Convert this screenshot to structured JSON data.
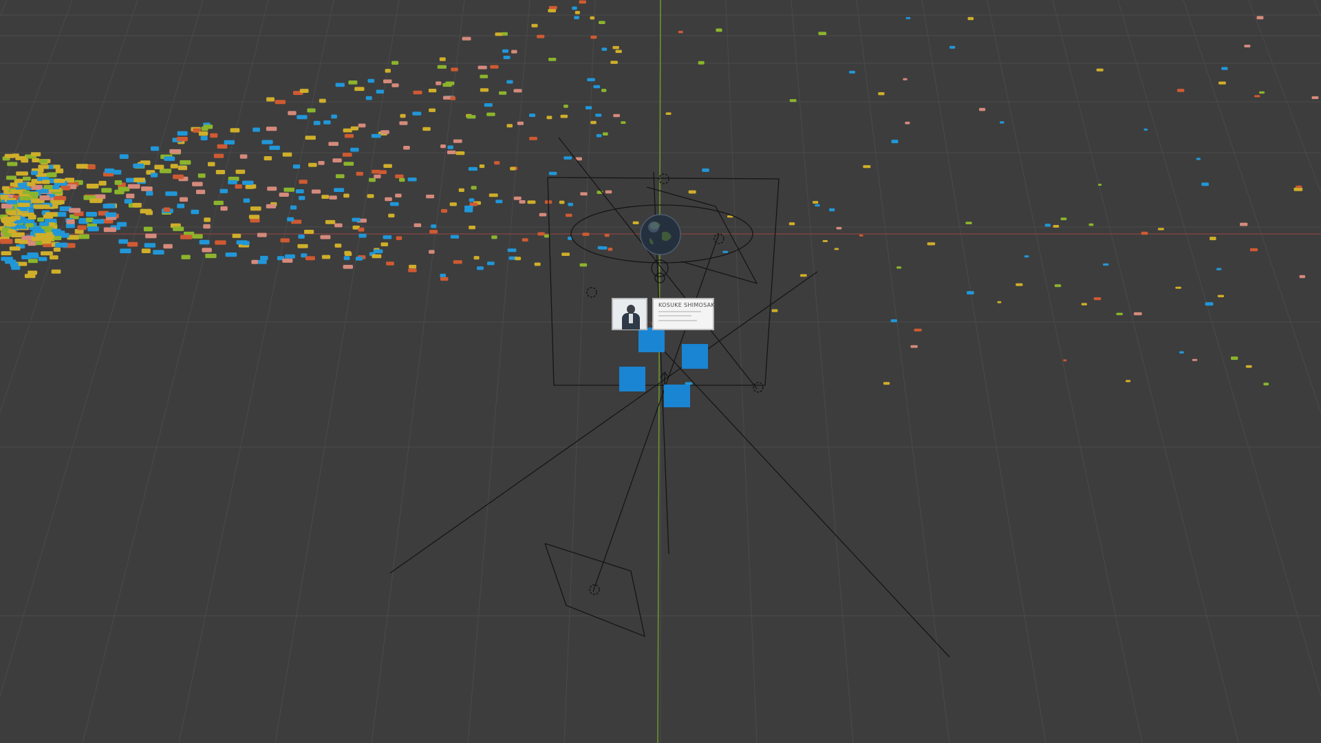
{
  "viewport": {
    "background_color": "#3d3d3d",
    "grid_color": "#4a4a4a",
    "x_axis_color": "#9a4545",
    "y_axis_color": "#6c9a2a",
    "wire_color": "#151515"
  },
  "object_colors": {
    "blue": "#2197d8",
    "yellow": "#cfae2a",
    "green": "#8bb42c",
    "orange": "#cf5a32",
    "pink": "#d58a7c",
    "cube_blue": "#1a85d3"
  },
  "objects": {
    "globe": "earth-globe",
    "camera_icons": [
      "camera-icon",
      "camera-icon",
      "camera-icon",
      "camera-icon",
      "camera-icon"
    ]
  },
  "profile_card": {
    "name": "KOSUKE SHIMOSAKI"
  }
}
